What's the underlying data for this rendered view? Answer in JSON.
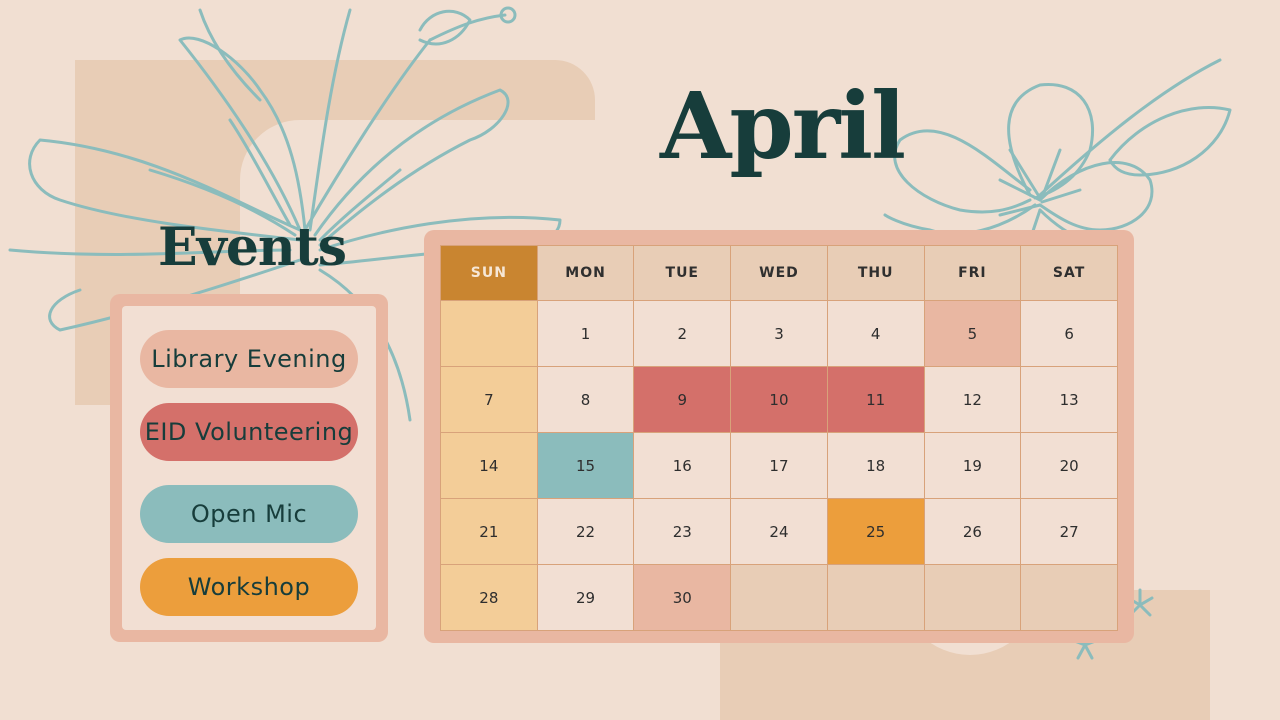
{
  "month": "April",
  "events_title": "Events",
  "events": [
    {
      "label": "Library Evening",
      "color": "#e9b7a2"
    },
    {
      "label": "EID Volunteering",
      "color": "#d4706a"
    },
    {
      "label": "Open  Mic",
      "color": "#8bbcbc"
    },
    {
      "label": "Workshop",
      "color": "#ec9e3c"
    }
  ],
  "calendar": {
    "days": [
      "SUN",
      "MON",
      "TUE",
      "WED",
      "THU",
      "FRI",
      "SAT"
    ],
    "weeks": [
      [
        "",
        "1",
        "2",
        "3",
        "4",
        "5",
        "6"
      ],
      [
        "7",
        "8",
        "9",
        "10",
        "11",
        "12",
        "13"
      ],
      [
        "14",
        "15",
        "16",
        "17",
        "18",
        "19",
        "20"
      ],
      [
        "21",
        "22",
        "23",
        "24",
        "25",
        "26",
        "27"
      ],
      [
        "28",
        "29",
        "30",
        "",
        "",
        "",
        ""
      ]
    ],
    "highlights": {
      "5": "#e9b7a2",
      "30": "#e9b7a2",
      "9": "#d4706a",
      "10": "#d4706a",
      "11": "#d4706a",
      "15": "#8bbcbc",
      "25": "#ec9e3c"
    }
  },
  "colors": {
    "background": "#f1dfd2",
    "title": "#173d3b",
    "floral_line": "#8bbcbc",
    "sunday_header": "#c98530",
    "sunday_column": "#f3cd98"
  }
}
